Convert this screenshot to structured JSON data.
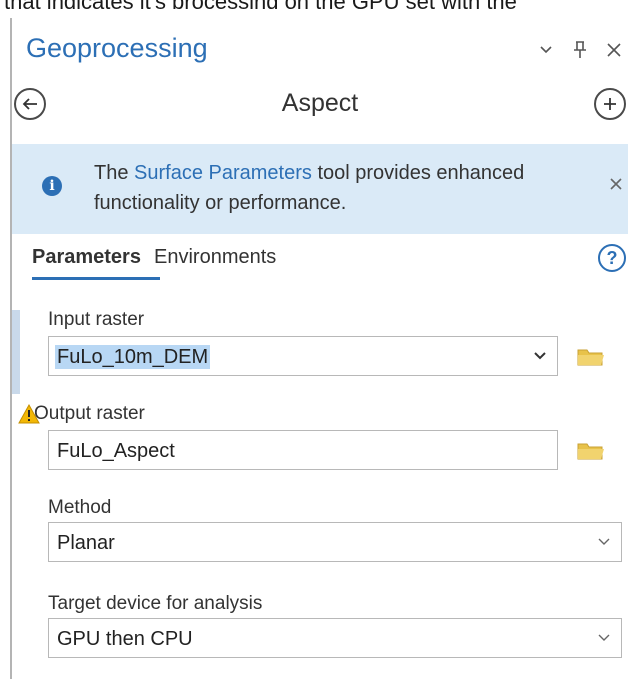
{
  "caption": "that indicates it's processing on the GPU set with the",
  "pane": {
    "title": "Geoprocessing",
    "title_icons": [
      "chevron-down-icon",
      "pin-icon",
      "close-icon"
    ]
  },
  "nav": {
    "back_icon": "arrow-left-icon",
    "tool_name": "Aspect",
    "add_icon": "plus-icon"
  },
  "info_banner": {
    "prefix": "The ",
    "link_text": "Surface Parameters",
    "suffix": " tool provides enhanced functionality or performance.",
    "icon": "info-icon",
    "close_icon": "close-icon"
  },
  "tabs": [
    {
      "label": "Parameters",
      "active": true
    },
    {
      "label": "Environments",
      "active": false
    }
  ],
  "help_icon": "question-icon",
  "params": {
    "input_raster": {
      "label": "Input raster",
      "value": "FuLo_10m_DEM"
    },
    "output_raster": {
      "label": "Output raster",
      "value": "FuLo_Aspect",
      "warning_icon": "warning-icon"
    },
    "method": {
      "label": "Method",
      "value": "Planar"
    },
    "target_device": {
      "label": "Target device for analysis",
      "value": "GPU then CPU"
    }
  },
  "colors": {
    "accent": "#2c6fb5",
    "banner_bg": "#daeaf7",
    "folder": "#e8c24a",
    "warning": "#f2b705"
  }
}
